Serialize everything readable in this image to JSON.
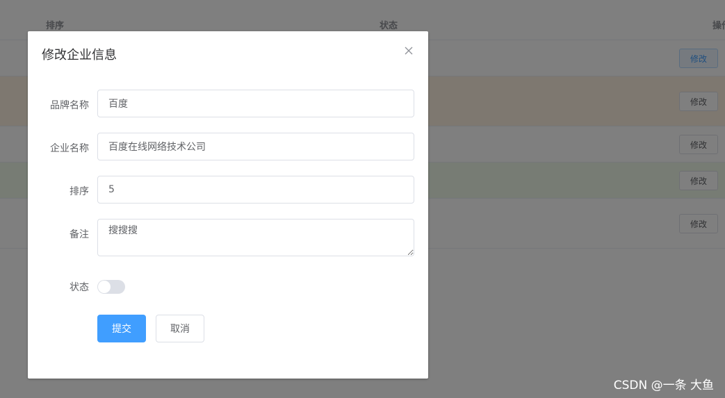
{
  "table": {
    "columns": [
      "排序",
      "状态",
      "操作"
    ],
    "rows": [
      {
        "action_label": "修改",
        "bg": "#ffffff",
        "active": true
      },
      {
        "action_label": "修改",
        "bg": "#fdf1e1"
      },
      {
        "action_label": "修改",
        "bg": "#ffffff"
      },
      {
        "action_label": "修改",
        "bg": "#eef8e8"
      },
      {
        "action_label": "修改",
        "bg": "#ffffff"
      }
    ]
  },
  "dialog": {
    "title": "修改企业信息",
    "fields": {
      "brand_name": {
        "label": "品牌名称",
        "value": "百度"
      },
      "company_name": {
        "label": "企业名称",
        "value": "百度在线网络技术公司"
      },
      "ordered": {
        "label": "排序",
        "value": "5"
      },
      "description": {
        "label": "备注",
        "value": "搜搜搜"
      },
      "status": {
        "label": "状态",
        "on": false
      }
    },
    "submit_label": "提交",
    "cancel_label": "取消"
  },
  "watermark": "CSDN @一条 大鱼",
  "colors": {
    "primary": "#409eff",
    "overlay": "rgba(0,0,0,0.5)"
  }
}
